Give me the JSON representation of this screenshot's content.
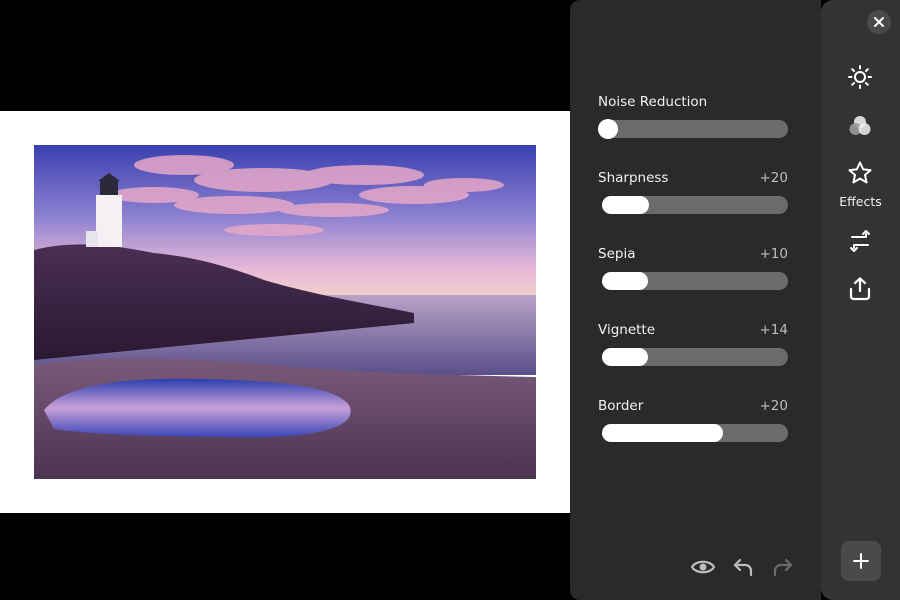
{
  "controls": [
    {
      "label": "Noise Reduction",
      "value": "",
      "level": 0.0
    },
    {
      "label": "Sharpness",
      "value": "+20",
      "level": 0.25
    },
    {
      "label": "Sepia",
      "value": "+10",
      "level": 0.15
    },
    {
      "label": "Vignette",
      "value": "+14",
      "level": 0.19
    },
    {
      "label": "Border",
      "value": "+20",
      "level": 0.65
    }
  ],
  "toolbar": {
    "active_label": "Effects",
    "icons": [
      "sun-icon",
      "color-circles-icon",
      "star-icon",
      "crop-icon",
      "export-icon"
    ]
  },
  "bottom_tools": [
    "eye-icon",
    "undo-icon",
    "redo-icon"
  ],
  "colors": {
    "panel_bg": "#2a2a2a",
    "toolbar_bg": "#333333",
    "track": "#6b6b6b",
    "fill": "#ffffff"
  }
}
